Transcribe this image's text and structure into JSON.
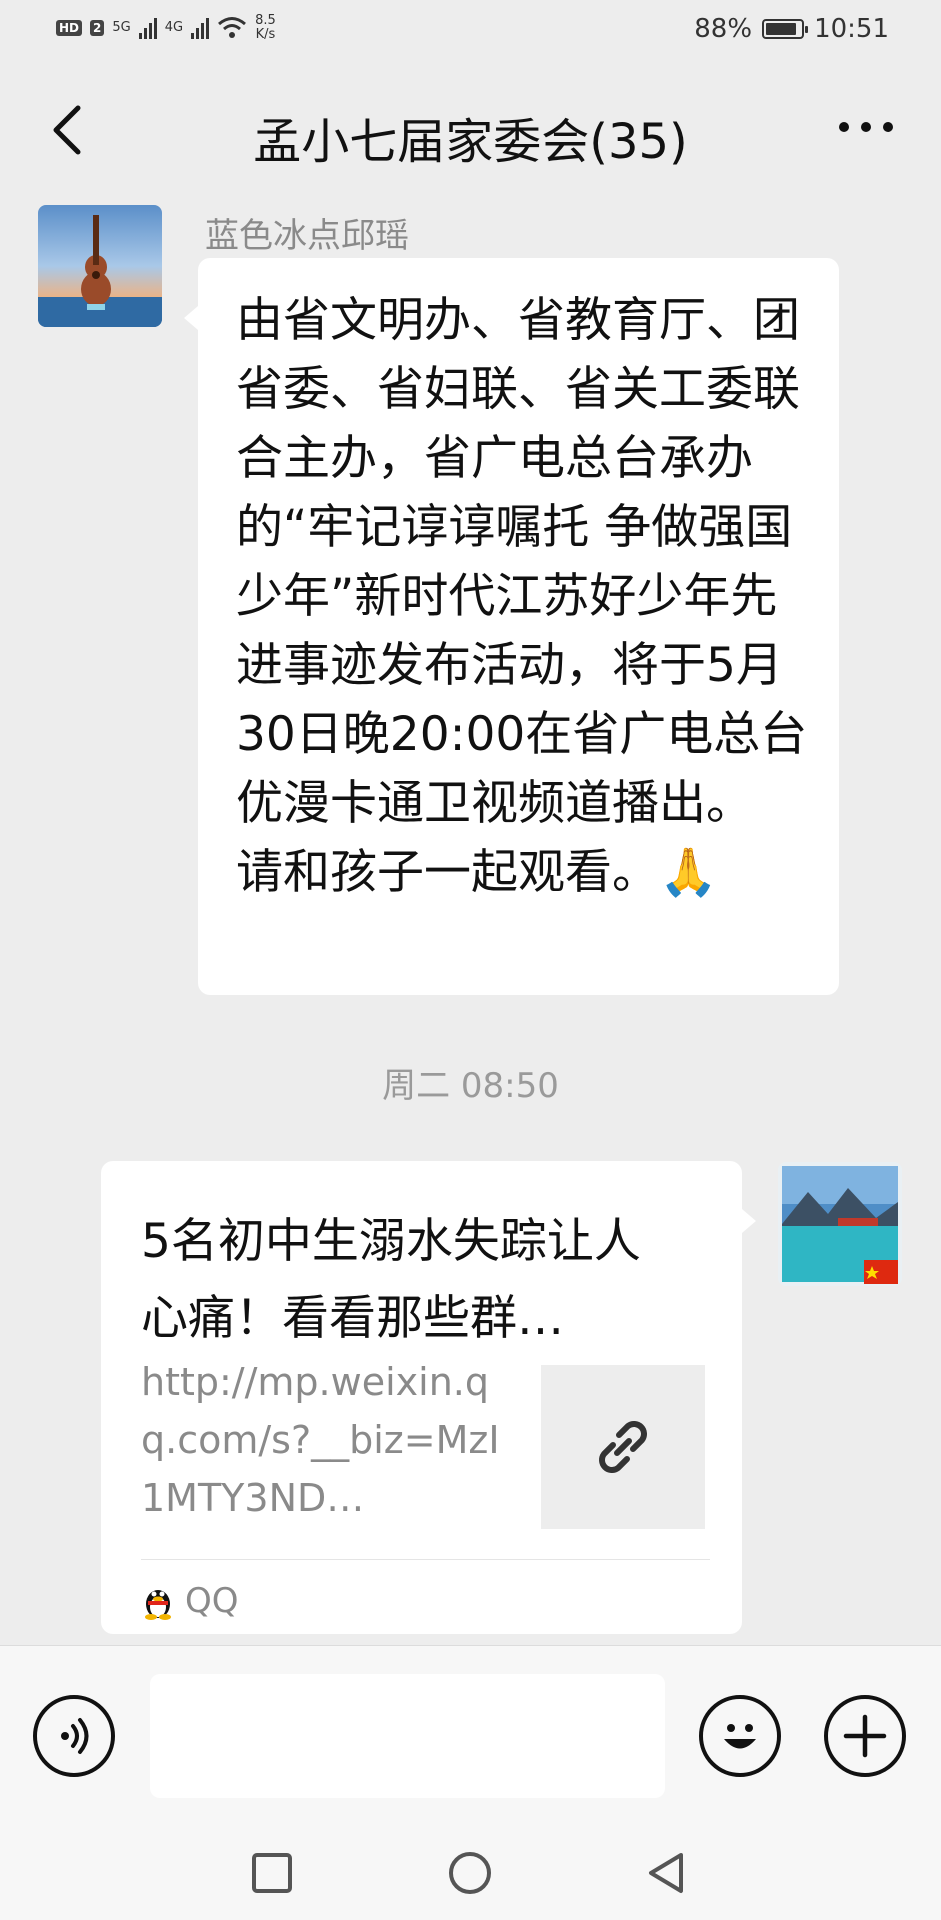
{
  "status_bar": {
    "hd_label": "HD",
    "sim_label": "2",
    "net1": "5G",
    "net2": "4G",
    "speed_value": "8.5",
    "speed_unit": "K/s",
    "battery": "88%",
    "battery_level": 0.88,
    "time": "10:51"
  },
  "header": {
    "title": "孟小七届家委会(35)"
  },
  "messages": [
    {
      "sender": "蓝色冰点邱瑶",
      "text": "由省文明办、省教育厅、团省委、省妇联、省关工委联合主办，省广电总台承办的“牢记谆谆嘱托 争做强国少年”新时代江苏好少年先进事迹发布活动，将于5月30日晚20:00在省广电总台优漫卡通卫视频道播出。\n请和孩子一起观看。🙏"
    },
    {
      "timestamp": "周二 08:50"
    },
    {
      "link_title": "5名初中生溺水失踪让人心痛！看看那些群…",
      "link_desc": "http://mp.weixin.qq.com/s?__biz=MzI1MTY3ND…",
      "link_source": "QQ",
      "thumb_icon": "link-icon"
    }
  ],
  "input_bar": {
    "voice_icon": "voice-icon",
    "placeholder": "",
    "emoji_icon": "emoji-icon",
    "plus_icon": "plus-icon"
  },
  "nav_bar": {
    "recent_icon": "square-icon",
    "home_icon": "circle-icon",
    "back_icon": "triangle-back-icon"
  },
  "colors": {
    "background": "#ededed",
    "bubble": "#ffffff",
    "muted_text": "#8a8a8a"
  }
}
